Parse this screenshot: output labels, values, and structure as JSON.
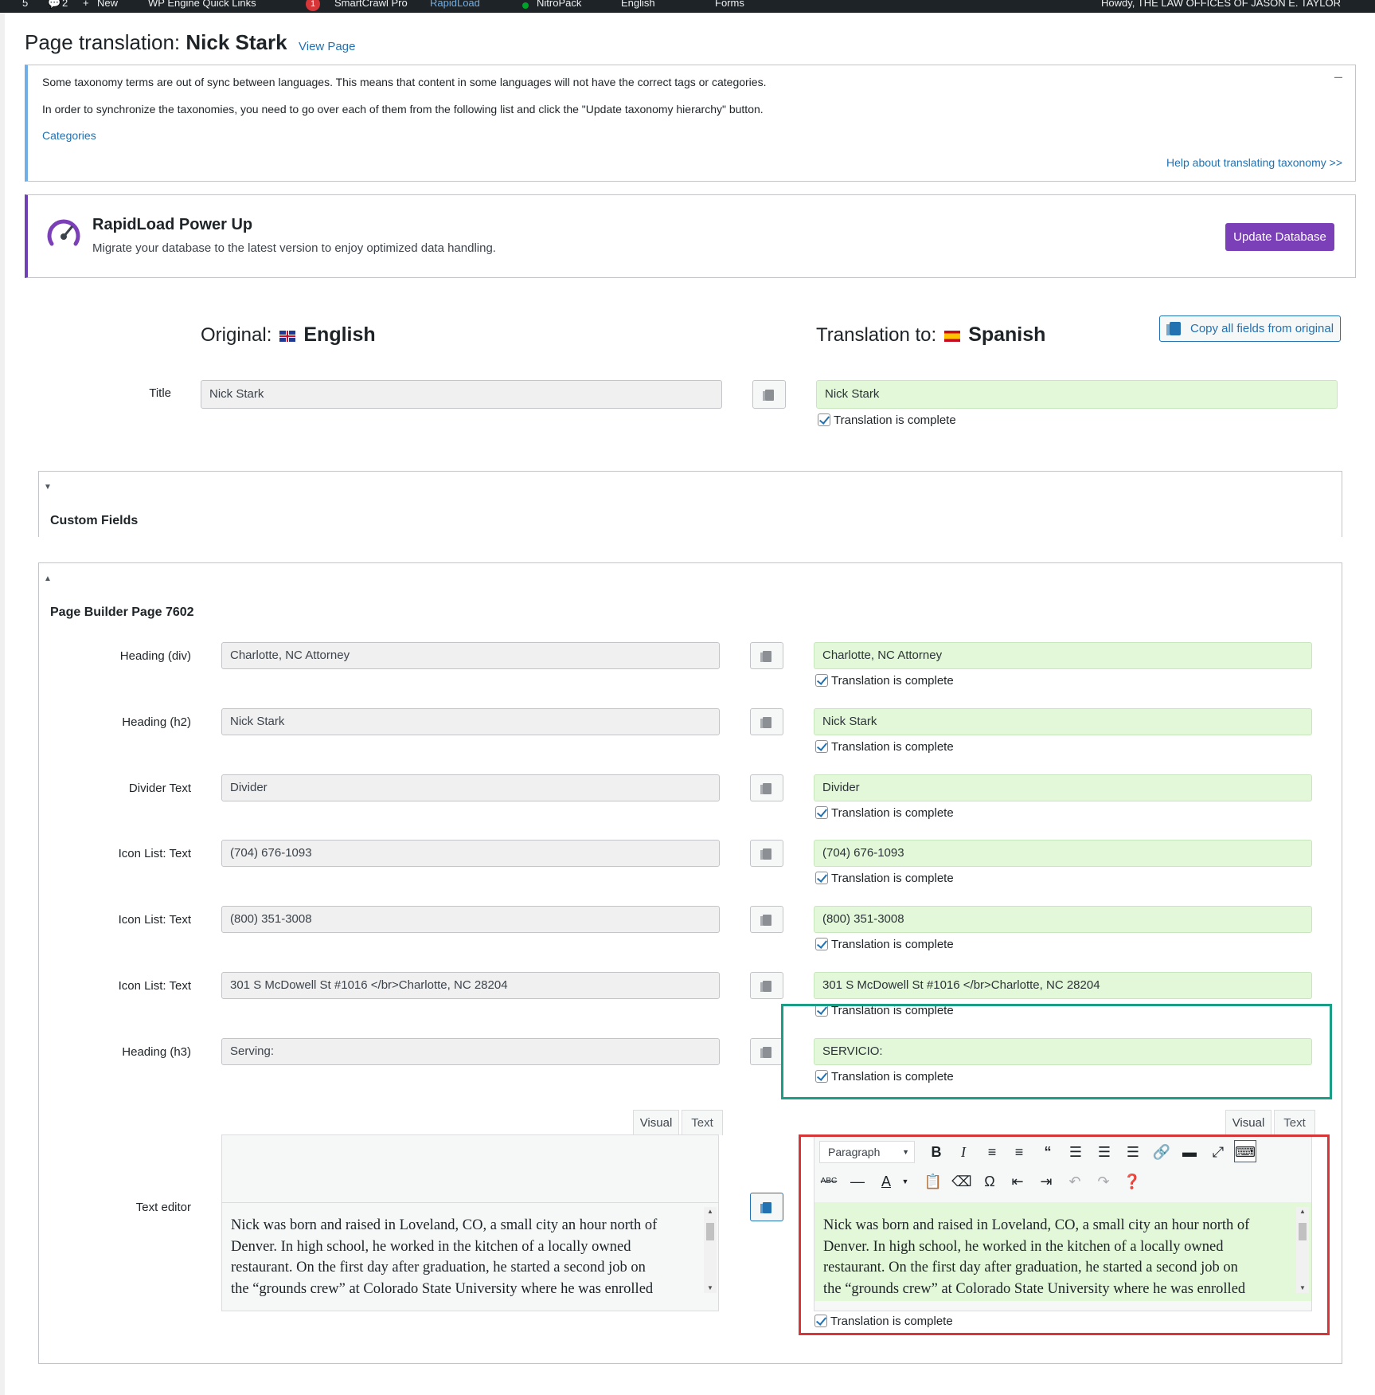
{
  "admin_bar": {
    "items": [
      "5",
      "2",
      "New",
      "WP Engine Quick Links",
      "1",
      "SmartCrawl Pro",
      "RapidLoad",
      "NitroPack",
      "English",
      "Forms"
    ],
    "howdy": "Howdy, THE LAW OFFICES OF JASON E. TAYLOR"
  },
  "page": {
    "title_prefix": "Page translation:",
    "title_name": "Nick Stark",
    "view_page": "View Page"
  },
  "notice": {
    "line1": "Some taxonomy terms are out of sync between languages. This means that content in some languages will not have the correct tags or categories.",
    "line2": "In order to synchronize the taxonomies, you need to go over each of them from the following list and click the \"Update taxonomy hierarchy\" button.",
    "categories_link": "Categories",
    "help_link": "Help about translating taxonomy >>",
    "dismiss": "–"
  },
  "rapidload": {
    "title": "RapidLoad Power Up",
    "desc": "Migrate your database to the latest version to enjoy optimized data handling.",
    "button": "Update Database"
  },
  "languages": {
    "original_label": "Original:",
    "original_lang": "English",
    "translation_label": "Translation to:",
    "translation_lang": "Spanish",
    "copy_all": "Copy all fields from original"
  },
  "title_row": {
    "label": "Title",
    "original": "Nick Stark",
    "translation": "Nick Stark"
  },
  "complete_label": "Translation is complete",
  "custom_fields": {
    "title": "Custom Fields"
  },
  "builder": {
    "title": "Page Builder Page 7602",
    "rows": [
      {
        "label": "Heading (div)",
        "original": "Charlotte, NC Attorney",
        "translation": "Charlotte, NC Attorney"
      },
      {
        "label": "Heading (h2)",
        "original": "Nick Stark",
        "translation": "Nick Stark"
      },
      {
        "label": "Divider Text",
        "original": "Divider",
        "translation": "Divider"
      },
      {
        "label": "Icon List: Text",
        "original": "(704) 676-1093",
        "translation": "(704) 676-1093"
      },
      {
        "label": "Icon List: Text",
        "original": "(800) 351-3008",
        "translation": "(800) 351-3008"
      },
      {
        "label": "Icon List: Text",
        "original": "301 S McDowell St #1016 </br>Charlotte, NC 28204",
        "translation": "301 S McDowell St #1016 </br>Charlotte, NC 28204"
      },
      {
        "label": "Heading (h3)",
        "original": "Serving:",
        "translation": "SERVICIO:"
      }
    ],
    "text_editor": {
      "label": "Text editor",
      "tab_visual": "Visual",
      "tab_text": "Text",
      "paragraph": "Paragraph",
      "lines": [
        "Nick was born and raised in Loveland, CO, a small city an hour north of",
        "Denver.  In high school, he worked in the kitchen of a locally owned",
        "restaurant.  On the first day after graduation, he started a second job on",
        "the “grounds crew” at Colorado State University where he was enrolled"
      ]
    }
  },
  "colors": {
    "accent": "#2271b1",
    "purple": "#7b3fb8",
    "translation_bg": "#e3f8d8",
    "highlight_green": "#1a9e86",
    "highlight_red": "#d63638"
  }
}
